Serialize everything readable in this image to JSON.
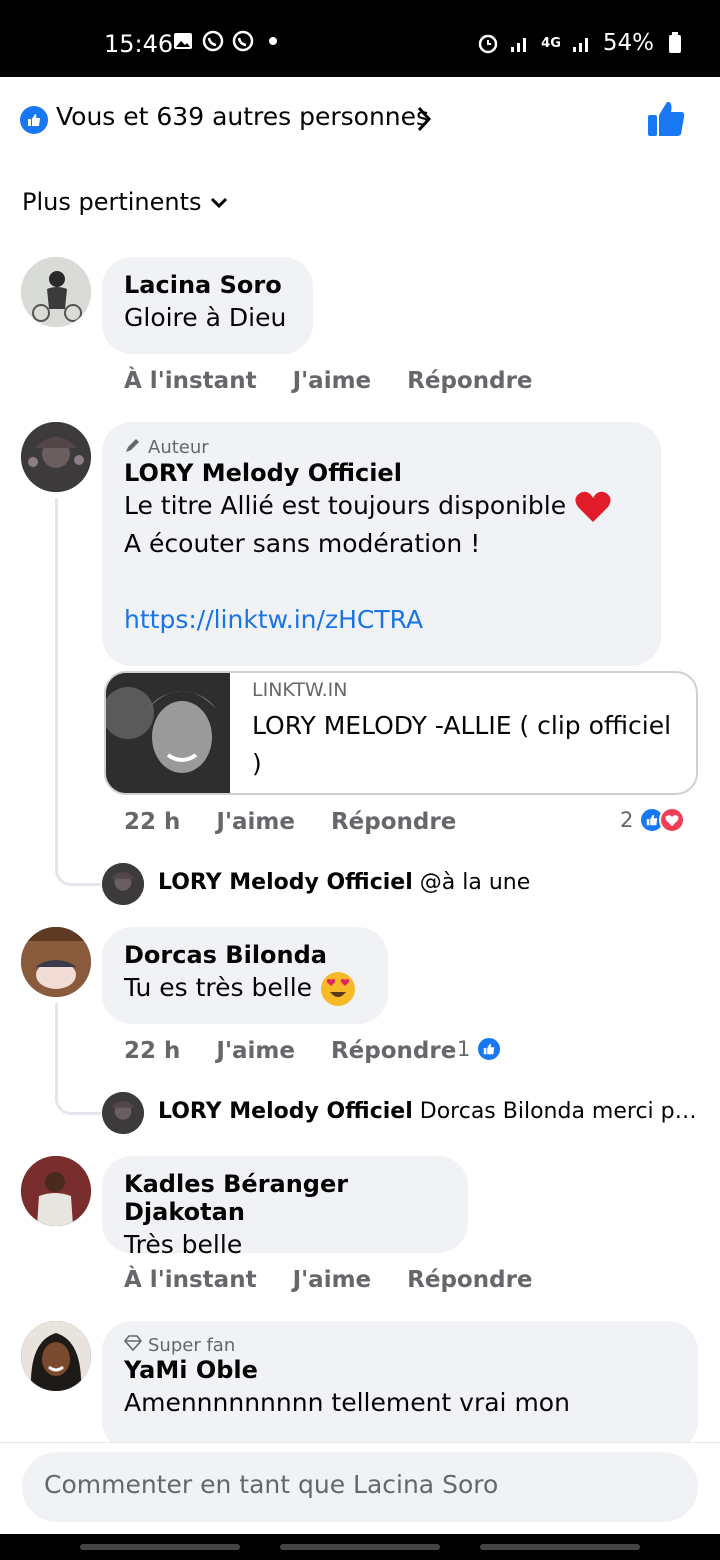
{
  "status_bar": {
    "time": "15:46",
    "battery": "54%",
    "network": "4G"
  },
  "reactions": {
    "text": "Vous et 639 autres personnes"
  },
  "sort": {
    "label": "Plus pertinents"
  },
  "comments": [
    {
      "name": "Lacina Soro",
      "text": "Gloire à Dieu",
      "time": "À l'instant",
      "like": "J'aime",
      "reply": "Répondre"
    },
    {
      "tag": "Auteur",
      "name": "LORY Melody Officiel",
      "line1": "Le titre Allié est toujours disponible",
      "line2": "A écouter sans modération !",
      "url": "https://linktw.in/zHCTRA",
      "card_domain": "LINKTW.IN",
      "card_title": "LORY MELODY -ALLIE ( clip officiel )",
      "time": "22 h",
      "like": "J'aime",
      "reply": "Répondre",
      "reaction_count": "2",
      "reply_name": "LORY Melody Officiel",
      "reply_text": "@à la une"
    },
    {
      "name": "Dorcas Bilonda",
      "text": "Tu es très belle",
      "time": "22 h",
      "like": "J'aime",
      "reply": "Répondre",
      "reaction_count": "1",
      "reply_name": "LORY Melody Officiel",
      "reply_text": "Dorcas Bilonda merci prin..."
    },
    {
      "name": "Kadles Béranger Djakotan",
      "text": "Très belle",
      "time": "À l'instant",
      "like": "J'aime",
      "reply": "Répondre"
    },
    {
      "tag": "Super fan",
      "name": "YaMi Oble",
      "text": "Amennnnnnnnn tellement vrai mon"
    }
  ],
  "composer": {
    "placeholder": "Commenter en tant que Lacina Soro"
  },
  "colors": {
    "accent": "#1877f2",
    "bubble": "#f0f2f5",
    "meta": "#65676b",
    "love": "#f33e58"
  }
}
